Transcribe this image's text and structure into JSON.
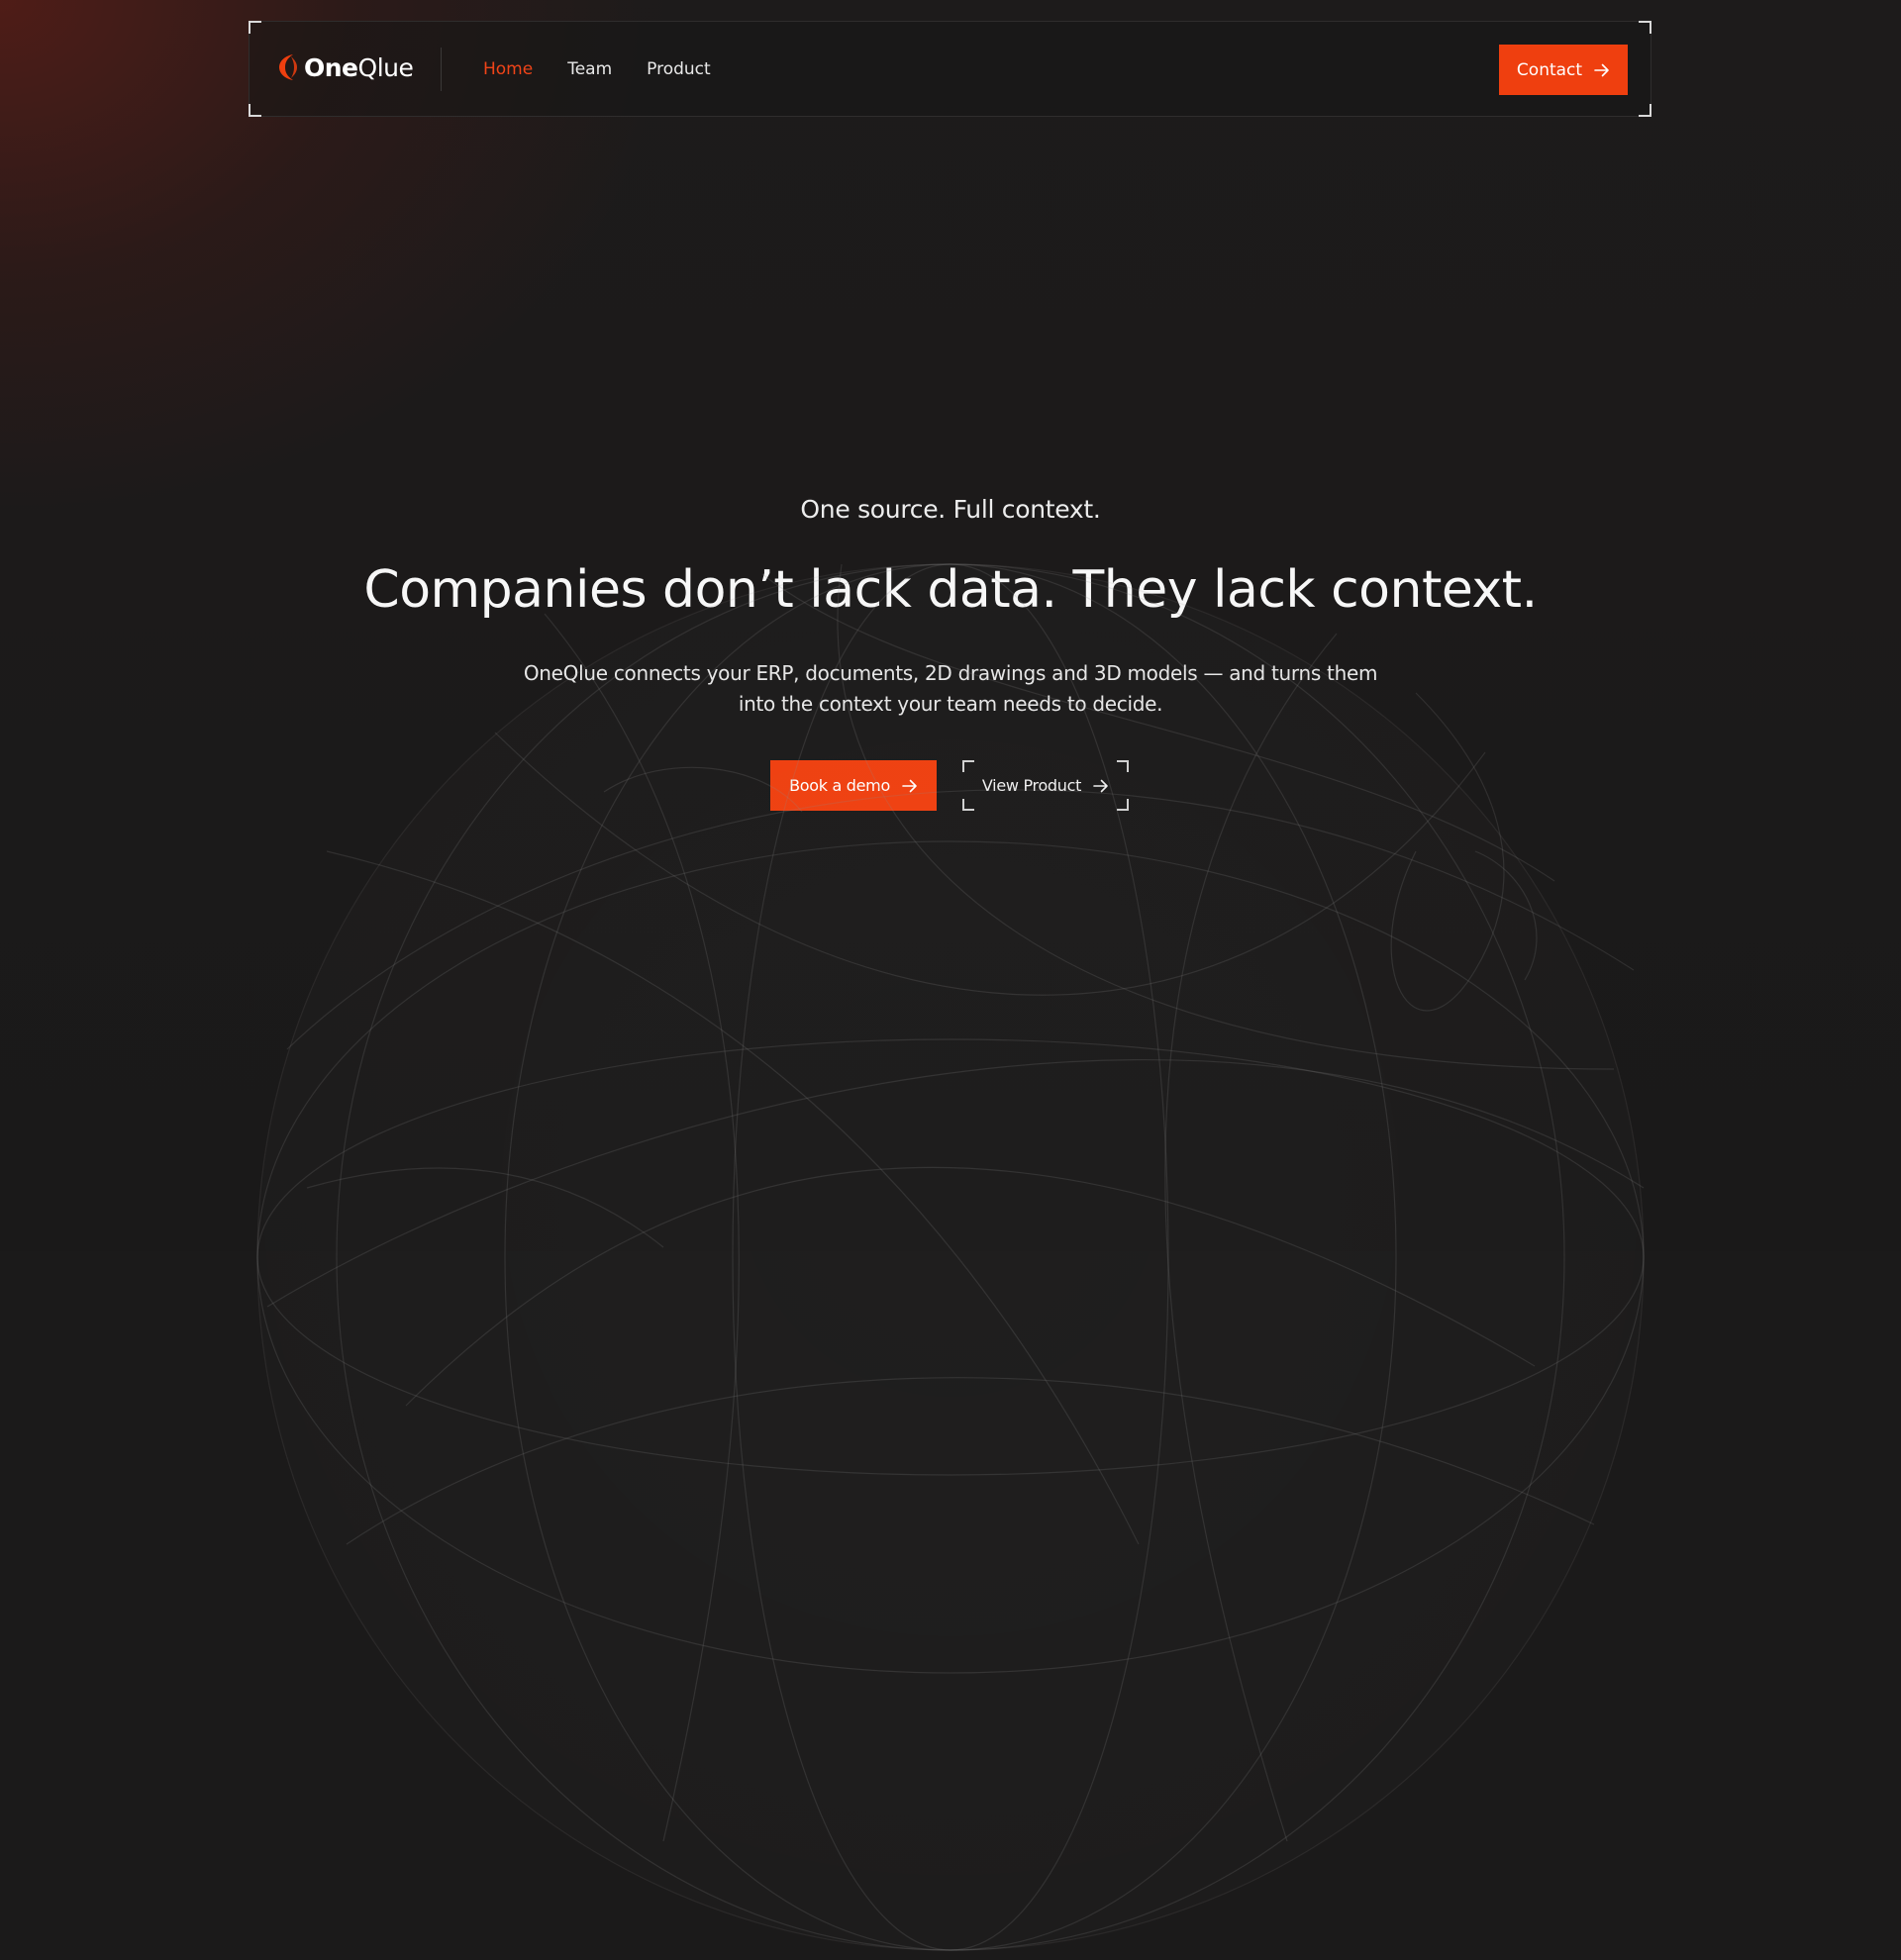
{
  "brand": {
    "name_bold": "One",
    "name_light": "Qlue",
    "accent_color": "#ef3f0f"
  },
  "nav": {
    "items": [
      {
        "label": "Home",
        "active": true
      },
      {
        "label": "Team",
        "active": false
      },
      {
        "label": "Product",
        "active": false
      }
    ],
    "contact_label": "Contact",
    "contact_icon": "arrow-right-icon"
  },
  "hero": {
    "eyebrow": "One source. Full context.",
    "headline": "Companies don’t lack data. They lack context.",
    "subtext": "OneQlue connects your ERP, documents, 2D drawings and 3D models — and turns them into the context your team needs to decide.",
    "primary_cta": "Book a demo",
    "secondary_cta": "View Product",
    "cta_icon": "arrow-right-icon"
  },
  "background": {
    "base_color": "#1b1a1a",
    "glow_color": "#781e14",
    "graphic": "wireframe-globe"
  }
}
